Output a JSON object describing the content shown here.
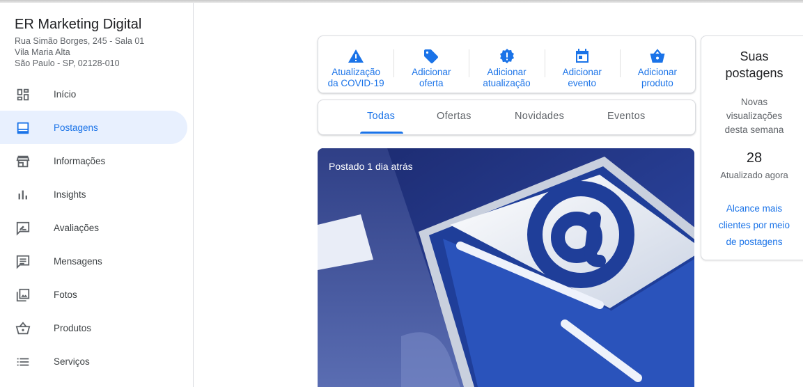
{
  "business": {
    "name": "ER Marketing Digital",
    "address_line1": "Rua Simão Borges, 245 - Sala 01",
    "address_line2": "Vila Maria Alta",
    "address_line3": "São Paulo - SP, 02128-010"
  },
  "sidebar": {
    "items": [
      {
        "label": "Início",
        "icon": "dashboard-icon"
      },
      {
        "label": "Postagens",
        "icon": "posts-icon",
        "active": true
      },
      {
        "label": "Informações",
        "icon": "store-icon"
      },
      {
        "label": "Insights",
        "icon": "bar-chart-icon"
      },
      {
        "label": "Avaliações",
        "icon": "reviews-icon"
      },
      {
        "label": "Mensagens",
        "icon": "message-icon"
      },
      {
        "label": "Fotos",
        "icon": "photos-icon"
      },
      {
        "label": "Produtos",
        "icon": "basket-icon"
      },
      {
        "label": "Serviços",
        "icon": "list-icon"
      }
    ]
  },
  "actions": [
    {
      "label": "Atualização\nda COVID-19",
      "icon": "warning-icon"
    },
    {
      "label": "Adicionar\noferta",
      "icon": "tag-icon"
    },
    {
      "label": "Adicionar\natualização",
      "icon": "update-badge-icon"
    },
    {
      "label": "Adicionar\nevento",
      "icon": "calendar-icon"
    },
    {
      "label": "Adicionar\nproduto",
      "icon": "basket-icon"
    }
  ],
  "tabs": [
    "Todas",
    "Ofertas",
    "Novidades",
    "Eventos"
  ],
  "active_tab": "Todas",
  "post": {
    "time": "Postado 1 dia atrás"
  },
  "stats": {
    "title_line1": "Suas",
    "title_line2": "postagens",
    "subtitle_line1": "Novas",
    "subtitle_line2": "visualizações",
    "subtitle_line3": "desta semana",
    "value": "28",
    "updated": "Atualizado agora",
    "link_line1": "Alcance mais",
    "link_line2": "clientes por meio",
    "link_line3": "de postagens"
  },
  "colors": {
    "accent": "#1a73e8",
    "active_bg": "#e8f0fe",
    "icon_gray": "#5f6368"
  }
}
